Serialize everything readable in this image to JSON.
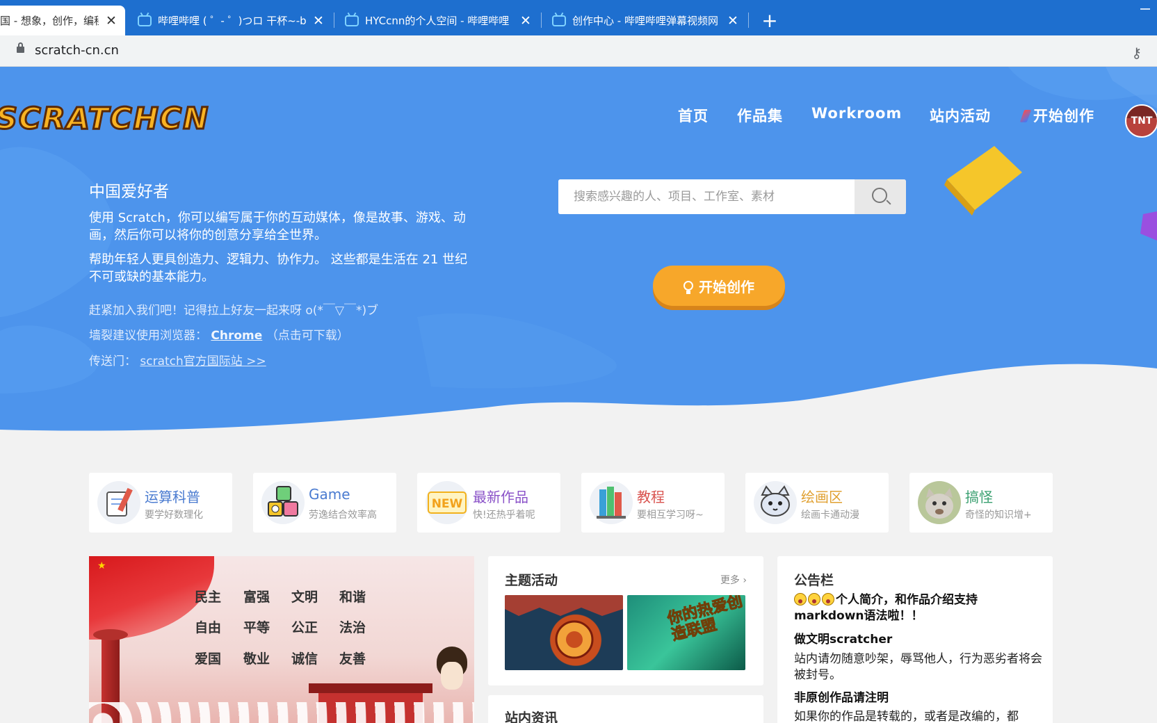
{
  "browser": {
    "tabs": [
      {
        "title": "国 - 想象，创作，编程",
        "active": true
      },
      {
        "title": "哔哩哔哩 ( ゜- ゜)つロ 干杯~-bilibili",
        "active": false
      },
      {
        "title": "HYCcnn的个人空间 - 哔哩哔哩 (",
        "active": false
      },
      {
        "title": "创作中心 - 哔哩哔哩弹幕视频网",
        "active": false
      }
    ],
    "new_tab": "+",
    "close_glyph": "✕",
    "url": "scratch-cn.cn"
  },
  "site": {
    "logo_text": "SCRATCHCN",
    "nav": [
      "首页",
      "作品集",
      "Workroom",
      "站内活动",
      "开始创作"
    ],
    "avatar_text": "TNT"
  },
  "hero": {
    "title": "中国爱好者",
    "desc1": "使用 Scratch，你可以编写属于你的互动媒体，像是故事、游戏、动画，然后你可以将你的创意分享给全世界。",
    "desc2": "帮助年轻人更具创造力、逻辑力、协作力。 这些都是生活在 21 世纪不可或缺的基本能力。",
    "join": "赶紧加入我们吧！记得拉上好友一起来呀 o(*￣▽￣*)ブ",
    "browser_prefix": "墙裂建议使用浏览器：",
    "browser_link": "Chrome",
    "browser_suffix": "（点击可下载）",
    "portal_prefix": "传送门：",
    "portal_link": "scratch官方国际站 >>",
    "search_placeholder": "搜索感兴趣的人、项目、工作室、素材",
    "cta": "开始创作"
  },
  "categories": [
    {
      "name": "运算科普",
      "sub": "要学好数理化",
      "color": "#4a7bd0",
      "icon": "pencil-notebook-icon"
    },
    {
      "name": "Game",
      "sub": "劳逸结合效率高",
      "color": "#4a7bd0",
      "icon": "game-blocks-icon"
    },
    {
      "name": "最新作品",
      "sub": "快!还热乎着呢",
      "color": "#8a52c8",
      "icon": "new-badge-icon"
    },
    {
      "name": "教程",
      "sub": "要相互学习呀~",
      "color": "#d9534f",
      "icon": "books-icon"
    },
    {
      "name": "绘画区",
      "sub": "绘画卡通动漫",
      "color": "#e0a030",
      "icon": "cat-face-icon"
    },
    {
      "name": "搞怪",
      "sub": "奇怪的知识增+",
      "color": "#3aa070",
      "icon": "funny-cat-icon"
    }
  ],
  "banner": {
    "values": [
      "民主",
      "富强",
      "文明",
      "和谐",
      "自由",
      "平等",
      "公正",
      "法治",
      "爱国",
      "敬业",
      "诚信",
      "友善"
    ]
  },
  "themes": {
    "title": "主题活动",
    "more": "更多",
    "thumb2_text": "你的热爱创造联盟"
  },
  "news": {
    "title": "站内资讯"
  },
  "notice": {
    "title": "公告栏",
    "line1": "个人简介，和作品介绍支持markdown语法啦！！",
    "heading2": "做文明scratcher",
    "line2": "站内请勿随意吵架，辱骂他人，行为恶劣者将会被封号。",
    "heading3": "非原创作品请注明",
    "line3": "如果你的作品是转载的，或者是改编的，都"
  }
}
